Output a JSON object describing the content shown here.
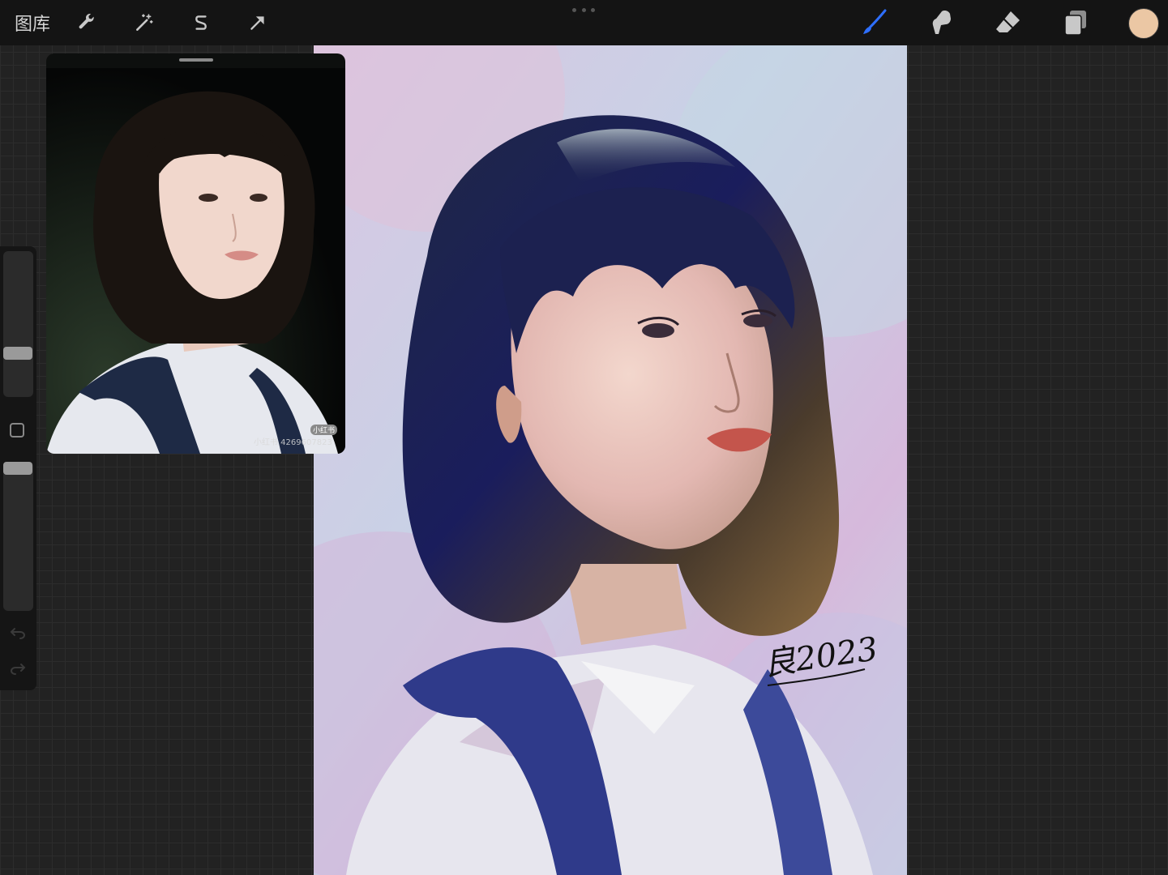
{
  "app": {
    "gallery_label": "图库"
  },
  "toolbar": {
    "left_icons": [
      "wrench-icon",
      "magic-wand-icon",
      "selection-s-icon",
      "transform-arrow-icon"
    ],
    "right_tools": [
      "brush-icon",
      "smudge-icon",
      "eraser-icon",
      "layers-icon"
    ],
    "active_tool": "brush",
    "active_color": "#ebc7a4",
    "accent": "#2e6fff"
  },
  "reference": {
    "watermark": "小红书  4269607823",
    "badge": "小红书"
  },
  "artwork": {
    "signature": "良2023"
  },
  "sidebar": {
    "brush_size_level": 0.28,
    "opacity_level": 1.0
  }
}
